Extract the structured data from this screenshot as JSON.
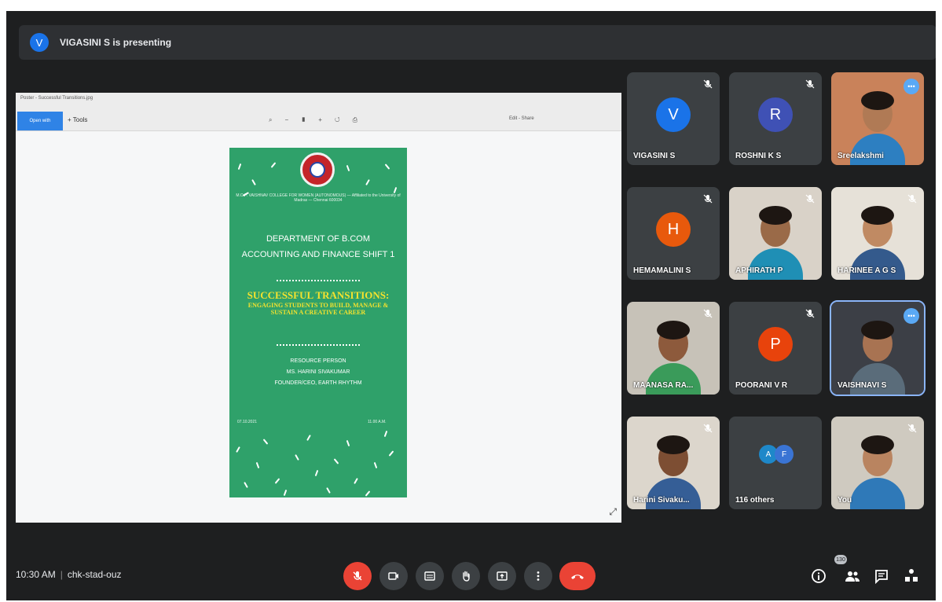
{
  "topbar": {
    "presenter_initial": "V",
    "presenting_text": "VIGASINI S is presenting"
  },
  "share": {
    "doc_name": "Poster - Successful Transitions.jpg",
    "button_label": "Open with",
    "plus_label": "+ Tools",
    "right_tools": "Edit - Share",
    "poster": {
      "college": "M.O.P. VAISHNAV COLLEGE FOR WOMEN (AUTONOMOUS) — Affiliated to the University of Madras — Chennai 600034",
      "dept_line1": "DEPARTMENT OF B.COM",
      "dept_line2": "ACCOUNTING AND FINANCE SHIFT 1",
      "event_title": "SUCCESSFUL TRANSITIONS:",
      "event_subtitle": "ENGAGING STUDENTS TO BUILD, MANAGE & SUSTAIN A CREATIVE CAREER",
      "resource_label": "RESOURCE PERSON",
      "resource_name": "MS. HARINI SIVAKUMAR",
      "resource_title": "FOUNDER/CEO, EARTH RHYTHM",
      "date_text": "07.10.2021",
      "time_text": "11.00 A.M."
    }
  },
  "participants": [
    {
      "name": "VIGASINI S",
      "initial": "V",
      "color": "#1a73e8",
      "type": "avatar",
      "muted": true
    },
    {
      "name": "ROSHNI K S",
      "initial": "R",
      "color": "#3f51b5",
      "type": "avatar",
      "muted": true
    },
    {
      "name": "Sreelakshmi",
      "type": "video",
      "more": "•••"
    },
    {
      "name": "HEMAMALINI S",
      "initial": "H",
      "color": "#e8590c",
      "type": "avatar",
      "muted": true
    },
    {
      "name": "APHIRATH P",
      "type": "video",
      "muted": true
    },
    {
      "name": "HARINEE A G S",
      "type": "video",
      "muted": true
    },
    {
      "name": "MAANASA RA...",
      "type": "video",
      "muted": true
    },
    {
      "name": "POORANI V R",
      "initial": "P",
      "color": "#e8430c",
      "type": "avatar",
      "muted": true
    },
    {
      "name": "VAISHNAVI S",
      "type": "video",
      "more": "•••"
    },
    {
      "name": "Harini Sivaku...",
      "type": "video",
      "muted": true
    },
    {
      "name": "116 others",
      "type": "group",
      "initials": [
        "A",
        "F"
      ]
    },
    {
      "name": "You",
      "type": "video",
      "muted": true
    }
  ],
  "bottom": {
    "time": "10:30 AM",
    "meeting_code": "chk-stad-ouz",
    "people_count": "130"
  },
  "colors": {
    "end_call": "#ea4335",
    "mic_off": "#ea4335",
    "frame": "#1e1f20",
    "tile": "#3c4043"
  }
}
